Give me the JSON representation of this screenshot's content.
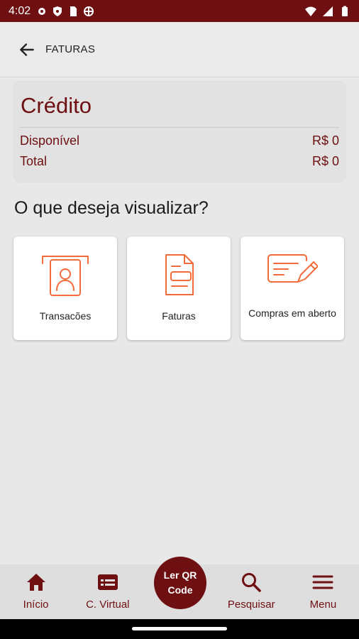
{
  "status_bar": {
    "time": "4:02",
    "icons": [
      "settings-icon",
      "shield-icon",
      "sim-card-icon",
      "vpn-icon",
      "wifi-icon",
      "signal-icon",
      "battery-icon"
    ]
  },
  "header": {
    "title": "FATURAS",
    "back_icon": "arrow-back-icon"
  },
  "credit": {
    "title": "Crédito",
    "rows": [
      {
        "label": "Disponível",
        "value": "R$ 0"
      },
      {
        "label": "Total",
        "value": "R$ 0"
      }
    ]
  },
  "question": "O que deseja visualizar?",
  "options": [
    {
      "label": "Transacões",
      "icon": "card-transactions-icon"
    },
    {
      "label": "Faturas",
      "icon": "invoice-document-icon"
    },
    {
      "label": "Compras em aberto",
      "icon": "open-purchases-edit-icon"
    }
  ],
  "bottom_nav": {
    "items": [
      {
        "label": "Início",
        "icon": "home-icon"
      },
      {
        "label": "C. Virtual",
        "icon": "virtual-card-icon"
      },
      {
        "label": "Pesquisar",
        "icon": "search-icon"
      },
      {
        "label": "Menu",
        "icon": "menu-icon"
      }
    ],
    "qr_label_line1": "Ler QR",
    "qr_label_line2": "Code"
  },
  "colors": {
    "brand": "#6e0f12",
    "accent_orange": "#f26b3a",
    "background": "#e8e8e8"
  }
}
